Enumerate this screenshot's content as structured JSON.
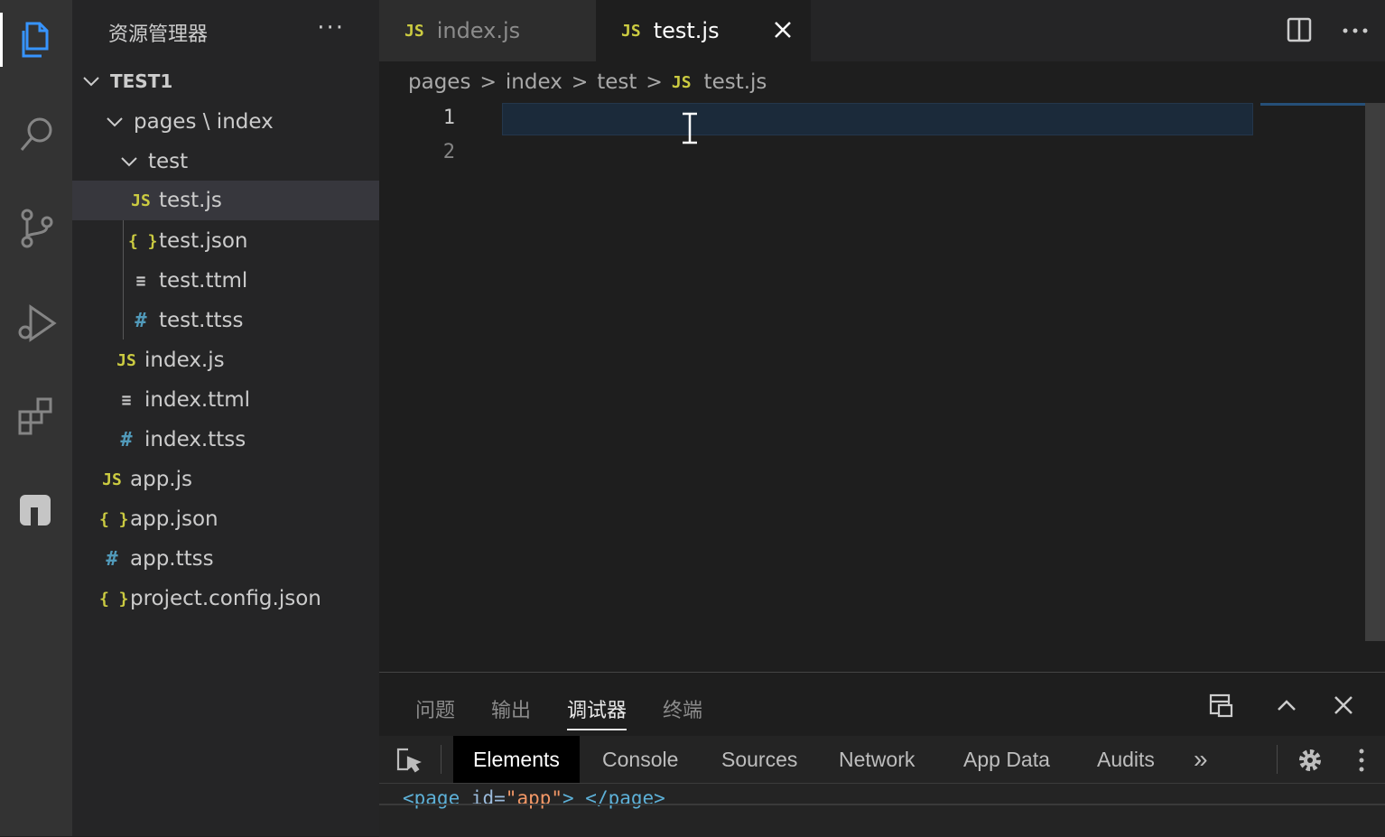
{
  "sidebar": {
    "title": "资源管理器",
    "more": "···",
    "root": "TEST1",
    "items": [
      {
        "label": "pages \\ index",
        "icon": "chevron-down-icon"
      },
      {
        "label": "test",
        "icon": "chevron-down-icon"
      },
      {
        "label": "test.js",
        "icon": "js-file-icon",
        "glyph": "JS"
      },
      {
        "label": "test.json",
        "icon": "json-file-icon",
        "glyph": "{ }"
      },
      {
        "label": "test.ttml",
        "icon": "ttml-file-icon",
        "glyph": "≡"
      },
      {
        "label": "test.ttss",
        "icon": "ttss-file-icon",
        "glyph": "#"
      },
      {
        "label": "index.js",
        "icon": "js-file-icon",
        "glyph": "JS"
      },
      {
        "label": "index.ttml",
        "icon": "ttml-file-icon",
        "glyph": "≡"
      },
      {
        "label": "index.ttss",
        "icon": "ttss-file-icon",
        "glyph": "#"
      },
      {
        "label": "app.js",
        "icon": "js-file-icon",
        "glyph": "JS"
      },
      {
        "label": "app.json",
        "icon": "json-file-icon",
        "glyph": "{ }"
      },
      {
        "label": "app.ttss",
        "icon": "ttss-file-icon",
        "glyph": "#"
      },
      {
        "label": "project.config.json",
        "icon": "json-file-icon",
        "glyph": "{ }"
      }
    ]
  },
  "tabs": [
    {
      "label": "index.js",
      "glyph": "JS",
      "active": false
    },
    {
      "label": "test.js",
      "glyph": "JS",
      "active": true
    }
  ],
  "breadcrumb": {
    "parts": [
      "pages",
      "index",
      "test"
    ],
    "file": "test.js",
    "file_glyph": "JS",
    "sep": ">"
  },
  "editor": {
    "line_numbers": [
      "1",
      "2"
    ]
  },
  "panel": {
    "tabs": [
      "问题",
      "输出",
      "调试器",
      "终端"
    ],
    "active_tab": "调试器"
  },
  "devtools": {
    "tabs": [
      "Elements",
      "Console",
      "Sources",
      "Network",
      "App Data",
      "Audits"
    ],
    "more": "»",
    "code": {
      "open_tag": "<page",
      "attr": " id=",
      "value": "\"app\"",
      "close": "> </page>"
    }
  },
  "colors": {
    "accent": "#cbcb41",
    "hash": "#519aba",
    "selection": "#37373d"
  }
}
